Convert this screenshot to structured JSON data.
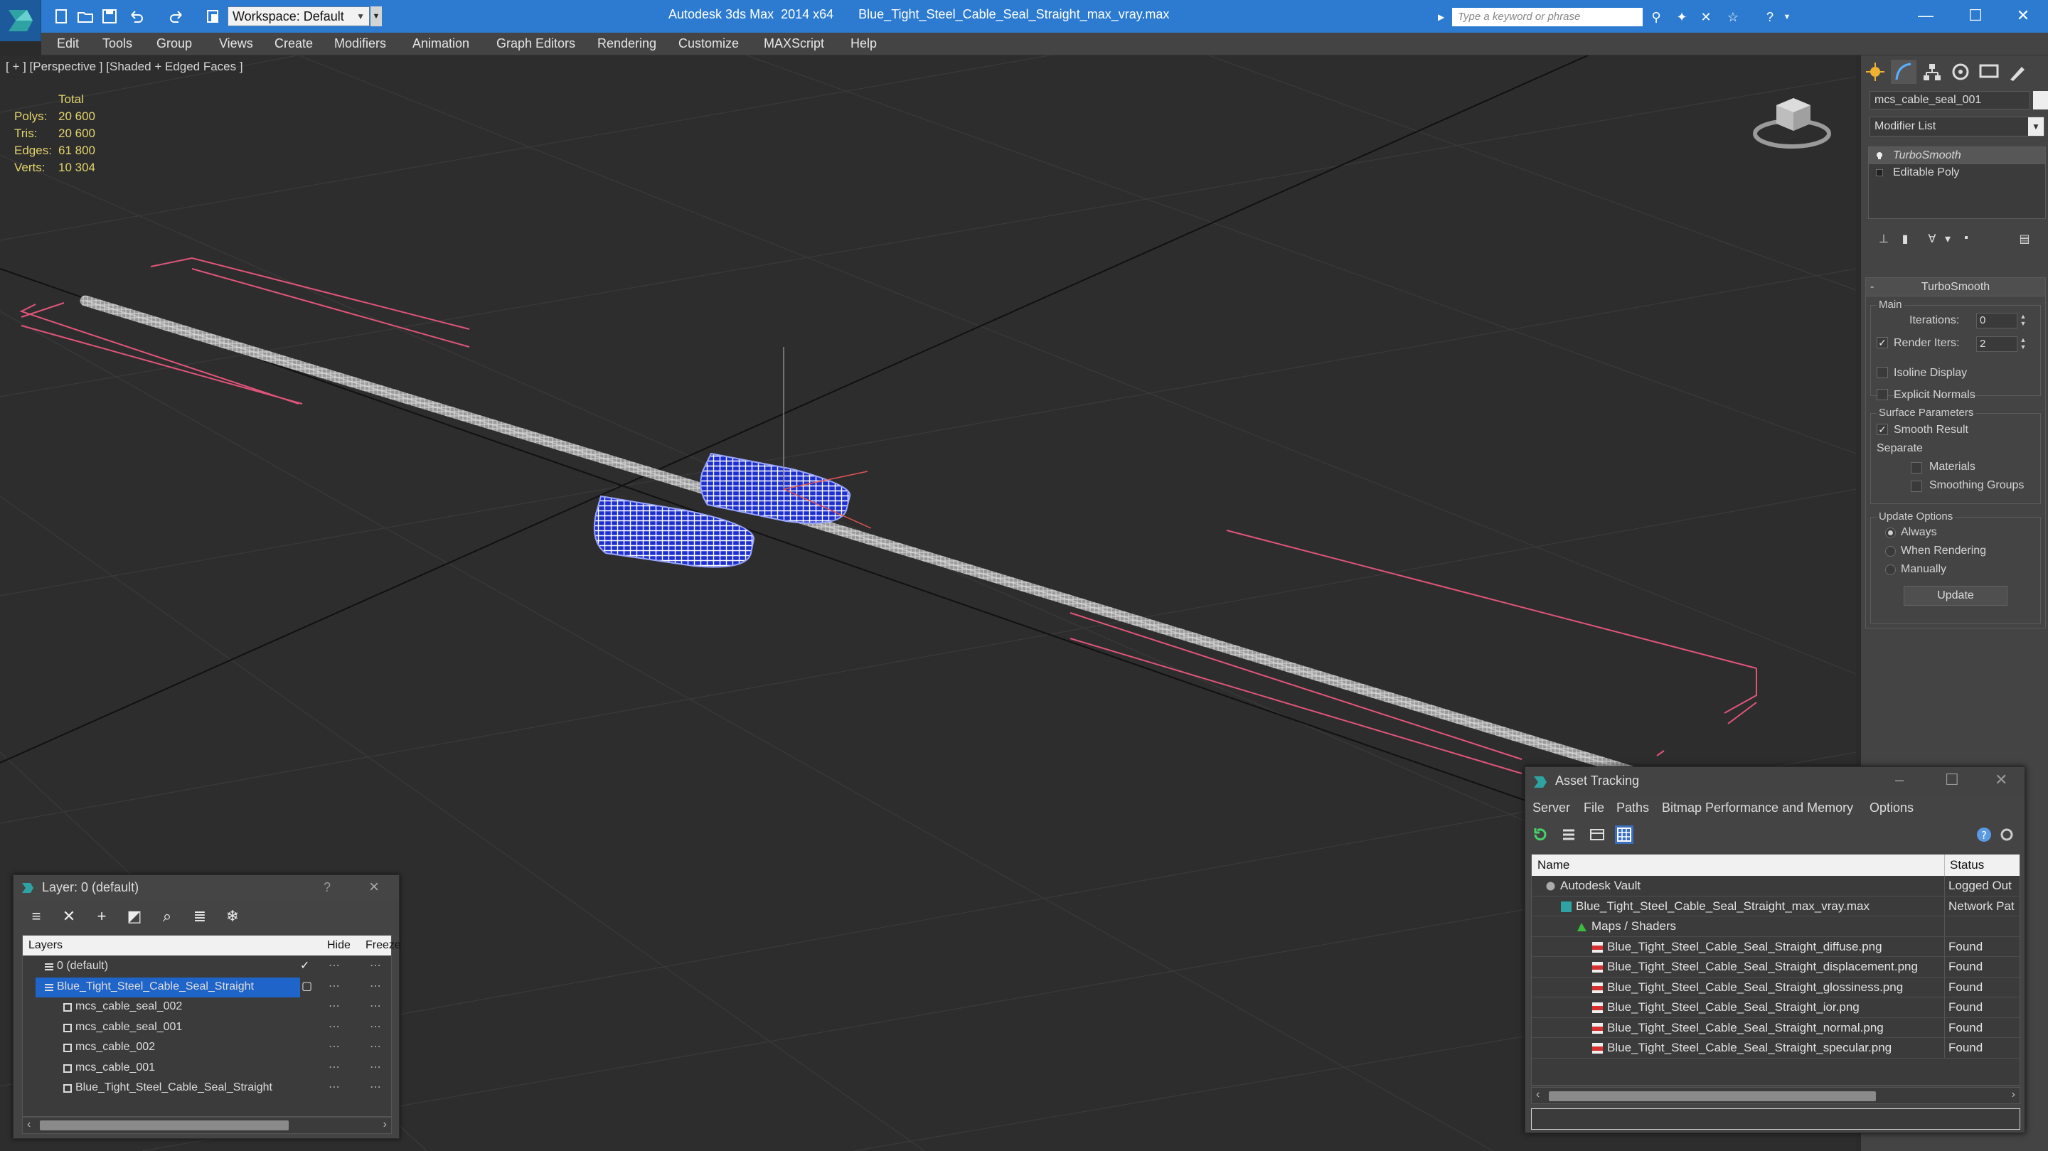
{
  "titlebar": {
    "workspace": "Workspace: Default",
    "window_title": "Autodesk 3ds Max  2014 x64       Blue_Tight_Steel_Cable_Seal_Straight_max_vray.max",
    "search_placeholder": "Type a keyword or phrase",
    "accent_color": "#2c7bd0"
  },
  "menu": {
    "items": [
      "Edit",
      "Tools",
      "Group",
      "Views",
      "Create",
      "Modifiers",
      "Animation",
      "Graph Editors",
      "Rendering",
      "Customize",
      "MAXScript",
      "Help"
    ]
  },
  "viewport": {
    "label": "[ + ] [Perspective ] [Shaded + Edged Faces ]",
    "stats": {
      "header": "Total",
      "rows": [
        {
          "key": "Polys:",
          "value": "20 600"
        },
        {
          "key": "Tris:",
          "value": "20 600"
        },
        {
          "key": "Edges:",
          "value": "61 800"
        },
        {
          "key": "Verts:",
          "value": "10 304"
        }
      ]
    },
    "wire_color": "#2a3bd6",
    "bbox_color": "#e0557a"
  },
  "command_panel": {
    "object_name": "mcs_cable_seal_001",
    "modifier_list": "Modifier List",
    "stack": [
      {
        "label": "TurboSmooth",
        "selected": true,
        "icon": "lightbulb-icon"
      },
      {
        "label": "Editable Poly",
        "selected": false,
        "icon": "poly-icon"
      }
    ],
    "rollout_title": "TurboSmooth",
    "main_group": "Main",
    "iterations_label": "Iterations:",
    "iterations_value": "0",
    "render_iters_label": "Render Iters:",
    "render_iters_value": "2",
    "render_iters_checked": true,
    "isoline_label": "Isoline Display",
    "explicit_normals_label": "Explicit Normals",
    "surface_group": "Surface Parameters",
    "smooth_result_label": "Smooth Result",
    "separate_label": "Separate",
    "materials_label": "Materials",
    "smoothing_groups_label": "Smoothing Groups",
    "update_group": "Update Options",
    "always_label": "Always",
    "when_rendering_label": "When Rendering",
    "manually_label": "Manually",
    "update_button": "Update"
  },
  "layer_window": {
    "title": "Layer: 0 (default)",
    "help": "?",
    "columns": {
      "layers": "Layers",
      "hide": "Hide",
      "freeze": "Freeze"
    },
    "rows": [
      {
        "name": "0 (default)",
        "indent": 1,
        "selected": false,
        "active": true
      },
      {
        "name": "Blue_Tight_Steel_Cable_Seal_Straight",
        "indent": 1,
        "selected": true,
        "active": false
      },
      {
        "name": "mcs_cable_seal_002",
        "indent": 2,
        "selected": false,
        "active": false
      },
      {
        "name": "mcs_cable_seal_001",
        "indent": 2,
        "selected": false,
        "active": false
      },
      {
        "name": "mcs_cable_002",
        "indent": 2,
        "selected": false,
        "active": false
      },
      {
        "name": "mcs_cable_001",
        "indent": 2,
        "selected": false,
        "active": false
      },
      {
        "name": "Blue_Tight_Steel_Cable_Seal_Straight",
        "indent": 2,
        "selected": false,
        "active": false
      }
    ]
  },
  "asset_window": {
    "title": "Asset Tracking",
    "menu": [
      "Server",
      "File",
      "Paths",
      "Bitmap Performance and Memory",
      "Options"
    ],
    "columns": {
      "name": "Name",
      "status": "Status"
    },
    "rows": [
      {
        "name": "Autodesk Vault",
        "status": "Logged Out",
        "level": 1,
        "icon": "vault-icon"
      },
      {
        "name": "Blue_Tight_Steel_Cable_Seal_Straight_max_vray.max",
        "status": "Network Pat",
        "level": 2,
        "icon": "max-file-icon"
      },
      {
        "name": "Maps / Shaders",
        "status": "",
        "level": 3,
        "icon": "maps-icon"
      },
      {
        "name": "Blue_Tight_Steel_Cable_Seal_Straight_diffuse.png",
        "status": "Found",
        "level": 4,
        "icon": "png-icon"
      },
      {
        "name": "Blue_Tight_Steel_Cable_Seal_Straight_displacement.png",
        "status": "Found",
        "level": 4,
        "icon": "png-icon"
      },
      {
        "name": "Blue_Tight_Steel_Cable_Seal_Straight_glossiness.png",
        "status": "Found",
        "level": 4,
        "icon": "png-icon"
      },
      {
        "name": "Blue_Tight_Steel_Cable_Seal_Straight_ior.png",
        "status": "Found",
        "level": 4,
        "icon": "png-icon"
      },
      {
        "name": "Blue_Tight_Steel_Cable_Seal_Straight_normal.png",
        "status": "Found",
        "level": 4,
        "icon": "png-icon"
      },
      {
        "name": "Blue_Tight_Steel_Cable_Seal_Straight_specular.png",
        "status": "Found",
        "level": 4,
        "icon": "png-icon"
      }
    ]
  }
}
